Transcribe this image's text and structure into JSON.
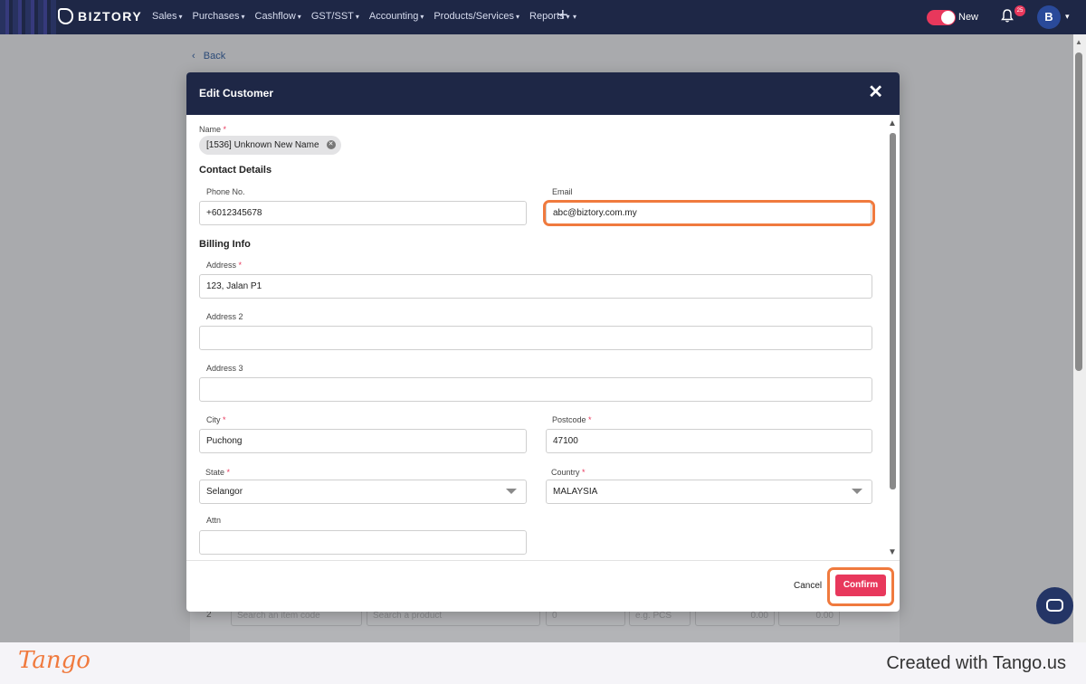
{
  "app": {
    "brand": "BIZTORY",
    "menu": [
      {
        "label": "Sales"
      },
      {
        "label": "Purchases"
      },
      {
        "label": "Cashflow"
      },
      {
        "label": "GST/SST"
      },
      {
        "label": "Accounting"
      },
      {
        "label": "Products/Services"
      },
      {
        "label": "Reports"
      }
    ],
    "toggle_label": "New",
    "notification_count": "25",
    "avatar_letter": "B"
  },
  "page": {
    "back_label": "Back",
    "bg_row": {
      "row_no": "2",
      "item_code_placeholder": "Search an item code",
      "product_placeholder": "Search a product",
      "qty": "0",
      "uom_placeholder": "e.g. PCS",
      "price": "0.00",
      "amount": "0.00"
    }
  },
  "modal": {
    "title": "Edit Customer",
    "name_label": "Name",
    "name_value": "[1536] Unknown New Name",
    "contact_section": "Contact Details",
    "phone_label": "Phone No.",
    "phone_value": "+6012345678",
    "email_label": "Email",
    "email_value": "abc@biztory.com.my",
    "billing_section": "Billing Info",
    "address_label": "Address",
    "address_value": "123, Jalan P1",
    "address2_label": "Address 2",
    "address2_value": "",
    "address3_label": "Address 3",
    "address3_value": "",
    "city_label": "City",
    "city_value": "Puchong",
    "postcode_label": "Postcode",
    "postcode_value": "47100",
    "state_label": "State",
    "state_value": "Selangor",
    "country_label": "Country",
    "country_value": "MALAYSIA",
    "attn_label": "Attn",
    "attn_value": "",
    "cancel_label": "Cancel",
    "confirm_label": "Confirm"
  },
  "footer": {
    "logo": "Tango",
    "credit": "Created with Tango.us"
  },
  "colors": {
    "nav_bg": "#1e2746",
    "accent": "#e8385c",
    "highlight": "#f07a3e"
  }
}
